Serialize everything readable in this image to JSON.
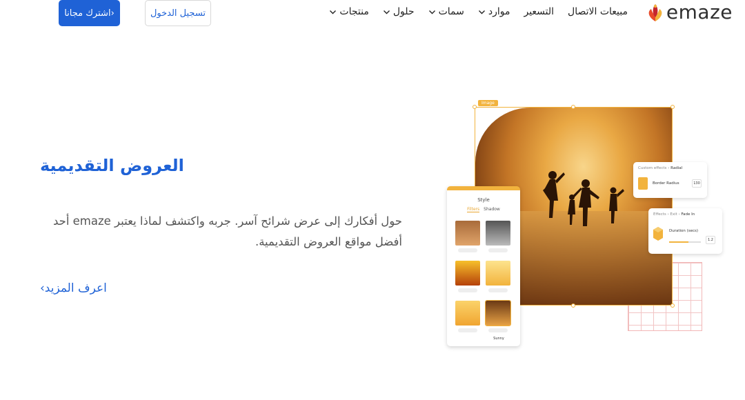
{
  "nav": {
    "logo_text": "emaze",
    "menu": [
      {
        "label": "منتجات",
        "has_dropdown": true
      },
      {
        "label": "حلول",
        "has_dropdown": true
      },
      {
        "label": "سمات",
        "has_dropdown": true
      },
      {
        "label": "موارد",
        "has_dropdown": true
      },
      {
        "label": "التسعير",
        "has_dropdown": false
      },
      {
        "label": "مبيعات الاتصال",
        "has_dropdown": false
      }
    ],
    "login_label": "تسجيل الدخول",
    "signup_label": "اشترك مجانا›"
  },
  "hero": {
    "title": "العروض التقديمية",
    "description": "حول أفكارك إلى عرض شرائح آسر. جربه واكتشف لماذا يعتبر emaze أحد أفضل مواقع العروض التقديمية.",
    "learn_more": "اعرف المزيد›"
  },
  "illustration": {
    "image_tag": "Image",
    "style_panel": {
      "title": "Style",
      "tab_active": "Filters",
      "tab_other": "Shadow",
      "selected_filter": "Sunny"
    },
    "card_radius": {
      "breadcrumb_prefix": "Custom effects › ",
      "breadcrumb_current": "Radial",
      "label": "Border Radius",
      "value": "130"
    },
    "card_fade": {
      "breadcrumb_prefix": "Effects › Exit › ",
      "breadcrumb_current": "Fade In",
      "label": "Duration (secs)",
      "value": "1.2"
    }
  },
  "colors": {
    "brand_blue": "#1f62d6",
    "accent_orange": "#f2b33d"
  }
}
